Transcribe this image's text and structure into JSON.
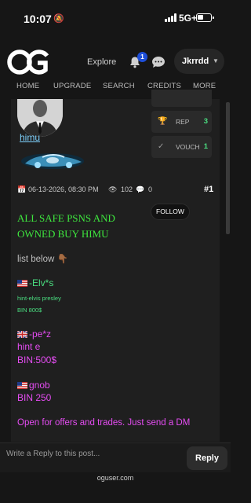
{
  "status_bar": {
    "time": "10:07",
    "network": "5G+"
  },
  "header": {
    "explore_label": "Explore",
    "notification_count": "1",
    "username": "Jkrrdd"
  },
  "nav": [
    "HOME",
    "UPGRADE",
    "SEARCH",
    "CREDITS",
    "MORE"
  ],
  "post": {
    "author": "himu",
    "stats": [
      {
        "label": "REP",
        "value": "3",
        "icon": "trophy-icon"
      },
      {
        "label": "VOUCH",
        "value": "1",
        "icon": "check-icon"
      }
    ],
    "date": "06-13-2026, 08:30 PM",
    "views": "102",
    "comments": "0",
    "number": "#1",
    "follow_label": "FOLLOW",
    "headline_1": "ALL SAFE PSNS AND",
    "headline_2": "OWNED BUY HIMU",
    "list_below": "list below 👇🏾",
    "item1_title": "-Elv*s",
    "item1_sub": "hint-elvis presley",
    "item1_bin": "BIN 800$",
    "item2_title": "-pe*z",
    "item2_hint": "hint e",
    "item2_bin": "BIN:500$",
    "item3_title": "gnob",
    "item3_bin": "BIN 250",
    "footer_line": "Open for offers and trades. Just send a DM"
  },
  "reply": {
    "placeholder": "Write a Reply to this post...",
    "button_label": "Reply"
  },
  "footer_domain": "oguser.com"
}
